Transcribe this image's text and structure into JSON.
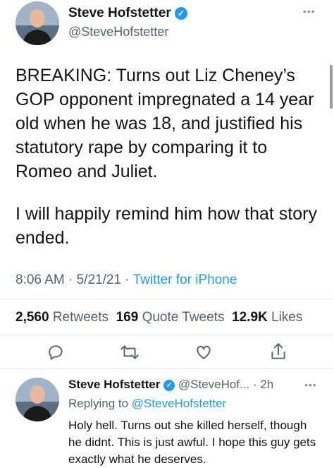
{
  "main_tweet": {
    "author_name": "Steve Hofstetter",
    "author_handle": "@SteveHofstetter",
    "text_p1": "BREAKING: Turns out Liz Cheney’s GOP opponent impregnated a 14 year old when he was 18, and justified his statutory rape by comparing it to Romeo and Juliet.",
    "text_p2": "I will happily remind him how that story ended.",
    "time": "8:06 AM",
    "date": "5/21/21",
    "source": "Twitter for iPhone",
    "retweets_count": "2,560",
    "retweets_label": "Retweets",
    "quotes_count": "169",
    "quotes_label": "Quote Tweets",
    "likes_count": "12.9K",
    "likes_label": "Likes"
  },
  "reply": {
    "author_name": "Steve Hofstetter",
    "author_handle_trunc": "@SteveHof...",
    "age": "· 2h",
    "replying_prefix": "Replying to",
    "replying_to": "@SteveHofstetter",
    "text": "Holy hell. Turns out she killed herself, though he didnt. This is just awful. I hope this guy gets exactly what he deserves."
  },
  "icons": {
    "verified": "verified-badge-icon",
    "more": "more-icon",
    "reply": "reply-icon",
    "retweet": "retweet-icon",
    "like": "like-icon",
    "share": "share-icon"
  },
  "colors": {
    "accent": "#1d9bf0",
    "text": "#0f1419",
    "secondary": "#536471",
    "divider": "#e1e8ed"
  }
}
